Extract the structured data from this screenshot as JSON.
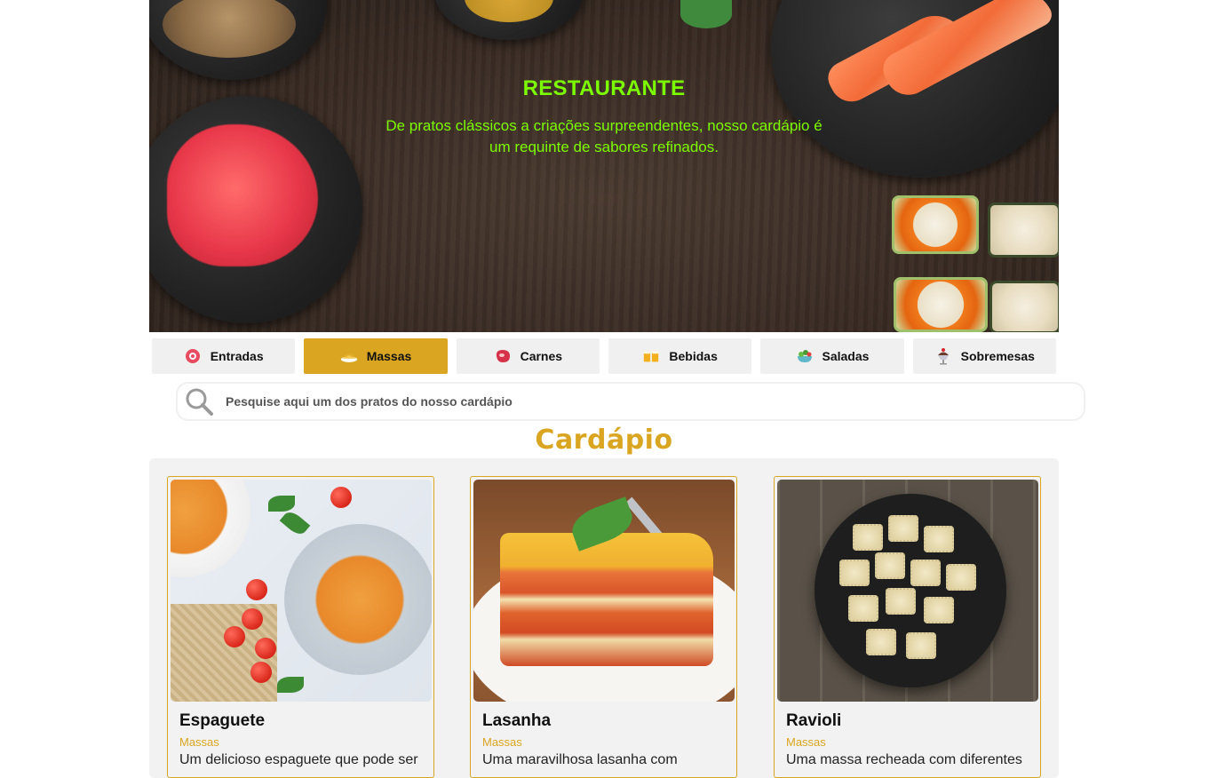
{
  "hero": {
    "title": "RESTAURANTE",
    "subtitle": "De pratos clássicos a criações surpreendentes, nosso cardápio é um requinte de sabores refinados."
  },
  "tabs": [
    {
      "label": "Entradas",
      "icon": "appetizer-icon",
      "active": false
    },
    {
      "label": "Massas",
      "icon": "pasta-icon",
      "active": true
    },
    {
      "label": "Carnes",
      "icon": "meat-icon",
      "active": false
    },
    {
      "label": "Bebidas",
      "icon": "drinks-icon",
      "active": false
    },
    {
      "label": "Saladas",
      "icon": "salad-icon",
      "active": false
    },
    {
      "label": "Sobremesas",
      "icon": "dessert-icon",
      "active": false
    }
  ],
  "search": {
    "placeholder": "Pesquise aqui um dos pratos do nosso cardápio"
  },
  "menu": {
    "title": "Cardápio",
    "items": [
      {
        "name": "Espaguete",
        "category": "Massas",
        "description": "Um delicioso espaguete que pode ser"
      },
      {
        "name": "Lasanha",
        "category": "Massas",
        "description": "Uma maravilhosa lasanha com"
      },
      {
        "name": "Ravioli",
        "category": "Massas",
        "description": "Uma massa recheada com diferentes"
      }
    ]
  },
  "colors": {
    "accent": "#daa520",
    "hero_text": "#7cfc00",
    "tab_background": "#f0f0f0",
    "menu_background": "#f2f2f2"
  }
}
